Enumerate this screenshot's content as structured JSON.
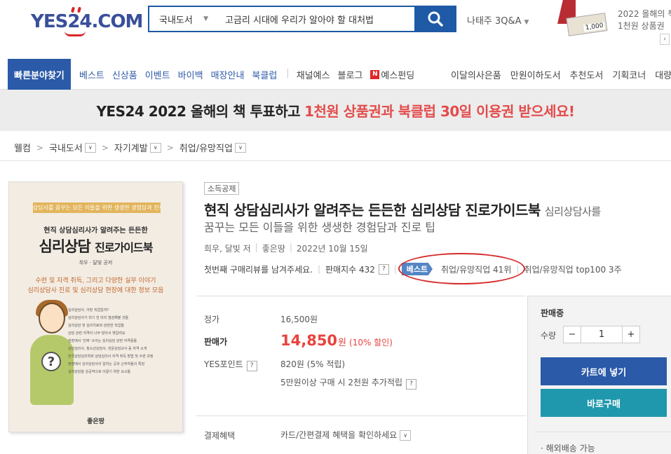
{
  "header": {
    "logo": "YES24.COM",
    "search": {
      "category": "국내도서",
      "query": "고금리 시대에 우리가 알아야 할 대처법"
    },
    "user_link": "나태주 3Q&A",
    "banner": {
      "voucher_amount": "1,000",
      "line1": "2022 올해의 책",
      "line2": "1천원 상품권"
    }
  },
  "nav": {
    "quick": "빠른분야찾기",
    "left": [
      "베스트",
      "신상품",
      "이벤트",
      "바이백",
      "매장안내",
      "북클럽"
    ],
    "left2": [
      "채널예스",
      "블로그"
    ],
    "yesfunding": "예스펀딩",
    "right": [
      "이달의사은품",
      "만원이하도서",
      "추천도서",
      "기획코너",
      "대량/"
    ]
  },
  "promo": {
    "main": "YES24 2022 올해의 책 투표하고",
    "highlight": "1천원 상품권과 북클럽 30일 이용권 받으세요!"
  },
  "breadcrumb": [
    "웰컴",
    "국내도서",
    "자기계발",
    "취업/유망직업"
  ],
  "cover": {
    "ribbon": "심리상담사를 꿈꾸는 모든 이들을 위한 생생한 경험담과 진로 팁",
    "line1": "현직 상담심리사가 알려주는 든든한",
    "line2a": "심리상담",
    "line2b": "진로가이드북",
    "authors": "최우 · 달빛 공저",
    "line4a": "수련 및 자격 취득, 그리고 다양한 실무 이야기",
    "line4b": "심리상담사 진로 및 심리상담 현장에 대한 정보 모음",
    "list": [
      "심리상담사, 어떤 직업일까?",
      "심리상담사가 되기 전 미리 점검해볼 것들",
      "심리상담 및 심리치료와 관련한 직업들",
      "상담 관련 자격이 너무 많아서 헷갈려요",
      "현장에서 '진짜' 쓰이는 심리상담 관련 자격증들",
      "상담심리사, 청소년상담사, 전문상담교사 등 자격 소개",
      "한국상담심리학회 상담심리사 자격 취득 방법 및 수련 과정",
      "현장에서 심리상담사의 일하는 곳과 근무처들의 특징",
      "심리상담을 성공적으로 이끌기 위한 요소들"
    ],
    "publisher": "좋은땅"
  },
  "book": {
    "badge": "소득공제",
    "title": "현직 상담심리사가 알려주는 든든한 심리상담 진로가이드북",
    "title_sub": "심리상담사를",
    "subtitle": "꿈꾸는 모든 이들을 위한 생생한 경험담과 진로 팁",
    "author": "희우, 달빛 저",
    "publisher": "좋은땅",
    "date": "2022년 10월 15일",
    "review": "첫번째 구매리뷰를 남겨주세요.",
    "sales_index": "판매지수 432",
    "best_label": "베스트",
    "rank1": "취업/유망직업 41위",
    "rank2": "취업/유망직업 top100 3주"
  },
  "price": {
    "list_label": "정가",
    "list_value": "16,500원",
    "sale_label": "판매가",
    "sale_value": "14,850",
    "sale_unit": "원",
    "discount": "(10% 할인)",
    "point_label": "YES포인트",
    "point_value": "820원 (5% 적립)",
    "extra": "5만원이상 구매 시 2천원 추가적립",
    "pay_label": "결제혜택",
    "pay_value": "카드/간편결제 혜택을 확인하세요"
  },
  "panel": {
    "status": "판매중",
    "qty_label": "수량",
    "qty": "1",
    "minus": "−",
    "plus": "+",
    "cart": "카트에 넣기",
    "buy": "바로구매",
    "shipping": "· 해외배송 가능"
  },
  "colors": {
    "brand": "#2a5aa8",
    "accent_red": "#e8433d",
    "teal": "#1f98ad"
  }
}
